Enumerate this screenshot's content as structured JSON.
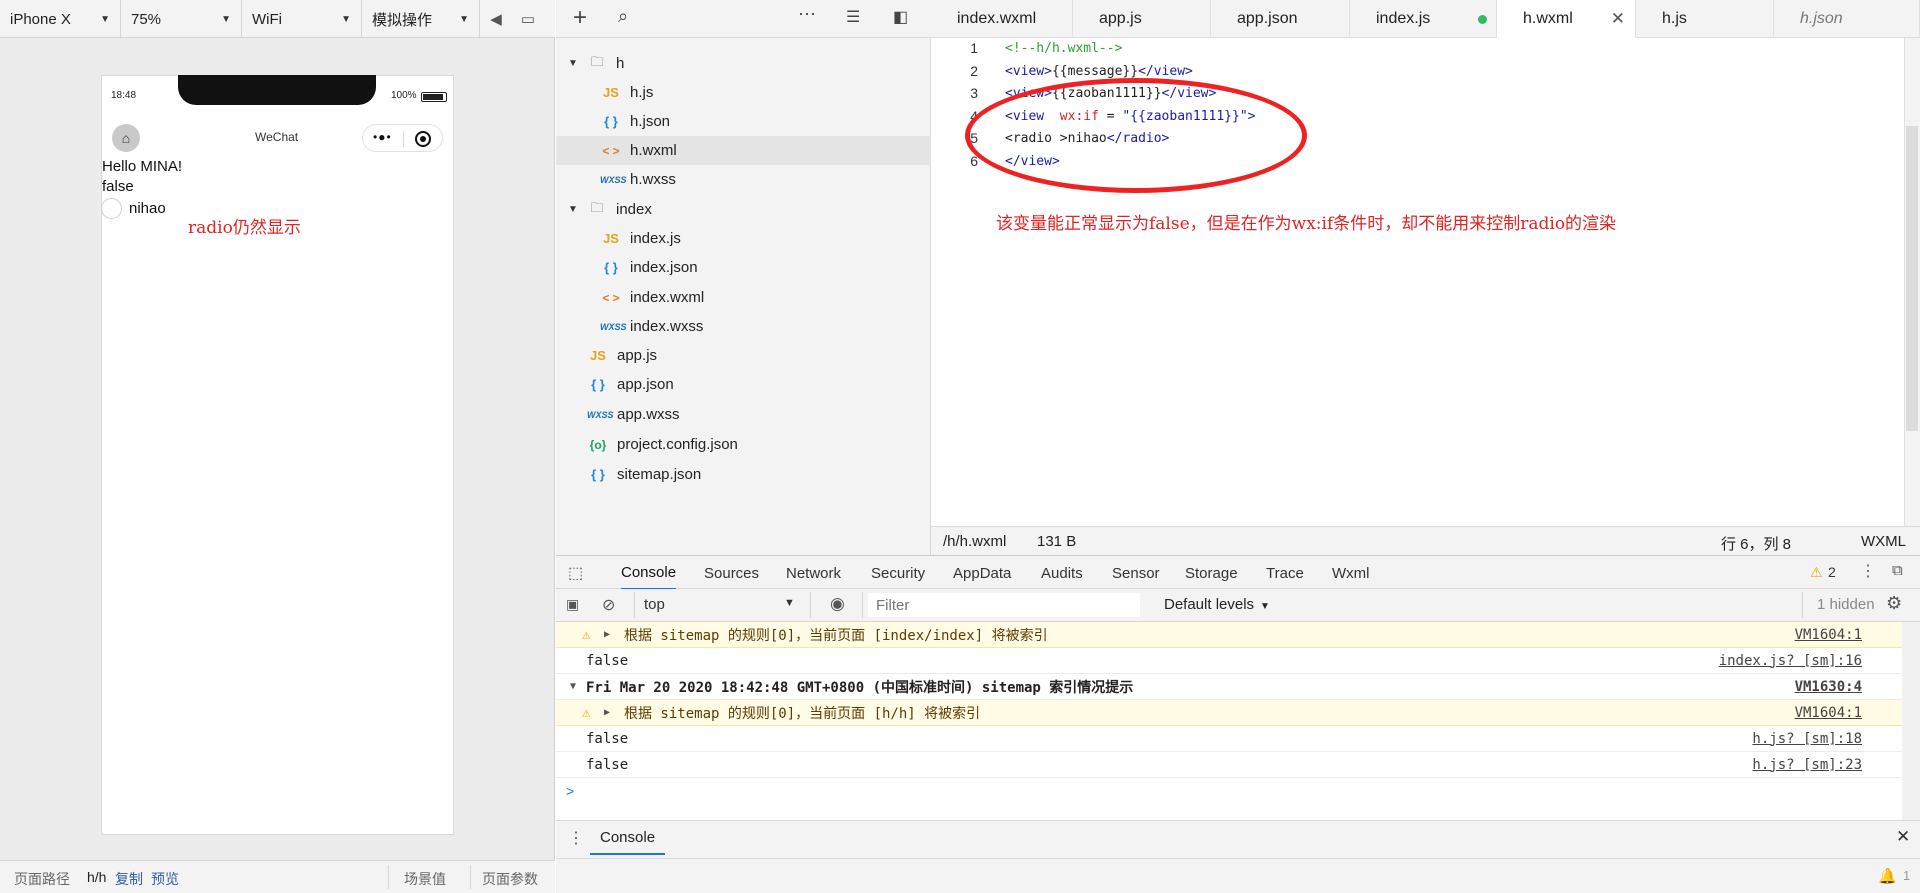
{
  "simulator": {
    "toolbar": {
      "device": "iPhone X",
      "zoom": "75%",
      "network": "WiFi",
      "action": "模拟操作"
    },
    "status_time": "18:48",
    "battery": "100%",
    "nav_title": "WeChat",
    "page_lines": [
      "Hello MINA!",
      "false"
    ],
    "radio_label": "nihao",
    "annotation": "radio仍然显示",
    "footer": {
      "path_label": "页面路径",
      "path_value": "h/h",
      "copy": "复制",
      "preview": "预览",
      "scene": "场景值",
      "params": "页面参数"
    }
  },
  "file_tree": {
    "items": [
      {
        "label": "h",
        "type": "folder"
      },
      {
        "label": "h.js",
        "type": "js"
      },
      {
        "label": "h.json",
        "type": "json"
      },
      {
        "label": "h.wxml",
        "type": "wxml",
        "selected": true
      },
      {
        "label": "h.wxss",
        "type": "wxss"
      },
      {
        "label": "index",
        "type": "folder"
      },
      {
        "label": "index.js",
        "type": "js"
      },
      {
        "label": "index.json",
        "type": "json"
      },
      {
        "label": "index.wxml",
        "type": "wxml"
      },
      {
        "label": "index.wxss",
        "type": "wxss"
      },
      {
        "label": "app.js",
        "type": "js"
      },
      {
        "label": "app.json",
        "type": "json"
      },
      {
        "label": "app.wxss",
        "type": "wxss"
      },
      {
        "label": "project.config.json",
        "type": "config"
      },
      {
        "label": "sitemap.json",
        "type": "json"
      }
    ]
  },
  "editor": {
    "tabs": [
      "index.wxml",
      "app.js",
      "app.json",
      "index.js",
      "h.wxml",
      "h.js",
      "h.json"
    ],
    "active_tab": "h.wxml",
    "line_numbers": [
      "1",
      "2",
      "3",
      "4",
      "5",
      "6"
    ],
    "code": {
      "l1": "<!--h/h.wxml-->",
      "l2_open": "<view>",
      "l2_text": "{{message}}",
      "l2_close": "</view>",
      "l3_open": "<view>",
      "l3_text": "{{zaoban1111}}",
      "l3_close": "</view>",
      "l4_open": "<view  ",
      "l4_attr": "wx:if",
      "l4_eq": " = ",
      "l4_val": "\"{{zaoban1111}}\"",
      "l4_close": ">",
      "l5_open": "<radio ",
      "l5_close": ">",
      "l5_text": "nihao",
      "l5_end": "</radio>",
      "l6": "</view>"
    },
    "annotation": "该变量能正常显示为false，但是在作为wx:if条件时，却不能用来控制radio的渲染",
    "status": {
      "path": "/h/h.wxml",
      "size": "131 B",
      "position": "行 6，列 8",
      "lang": "WXML"
    }
  },
  "devtools": {
    "tabs": [
      "Console",
      "Sources",
      "Network",
      "Security",
      "AppData",
      "Audits",
      "Sensor",
      "Storage",
      "Trace",
      "Wxml"
    ],
    "warn_count": "2",
    "context": "top",
    "filter_placeholder": "Filter",
    "levels": "Default levels",
    "hidden": "1 hidden",
    "rows": [
      {
        "msg": "根据 sitemap 的规则[0]，当前页面 [index/index] 将被索引",
        "src": "VM1604:1"
      },
      {
        "msg": "false",
        "src": "index.js? [sm]:16"
      },
      {
        "msg": "Fri Mar 20 2020 18:42:48 GMT+0800 (中国标准时间) sitemap 索引情况提示",
        "src": "VM1630:4"
      },
      {
        "msg": "根据 sitemap 的规则[0]，当前页面 [h/h] 将被索引",
        "src": "VM1604:1"
      },
      {
        "msg": "false",
        "src": "h.js? [sm]:18"
      },
      {
        "msg": "false",
        "src": "h.js? [sm]:23"
      }
    ],
    "prompt": ">",
    "drawer_tab": "Console",
    "bottom_count": "1"
  }
}
